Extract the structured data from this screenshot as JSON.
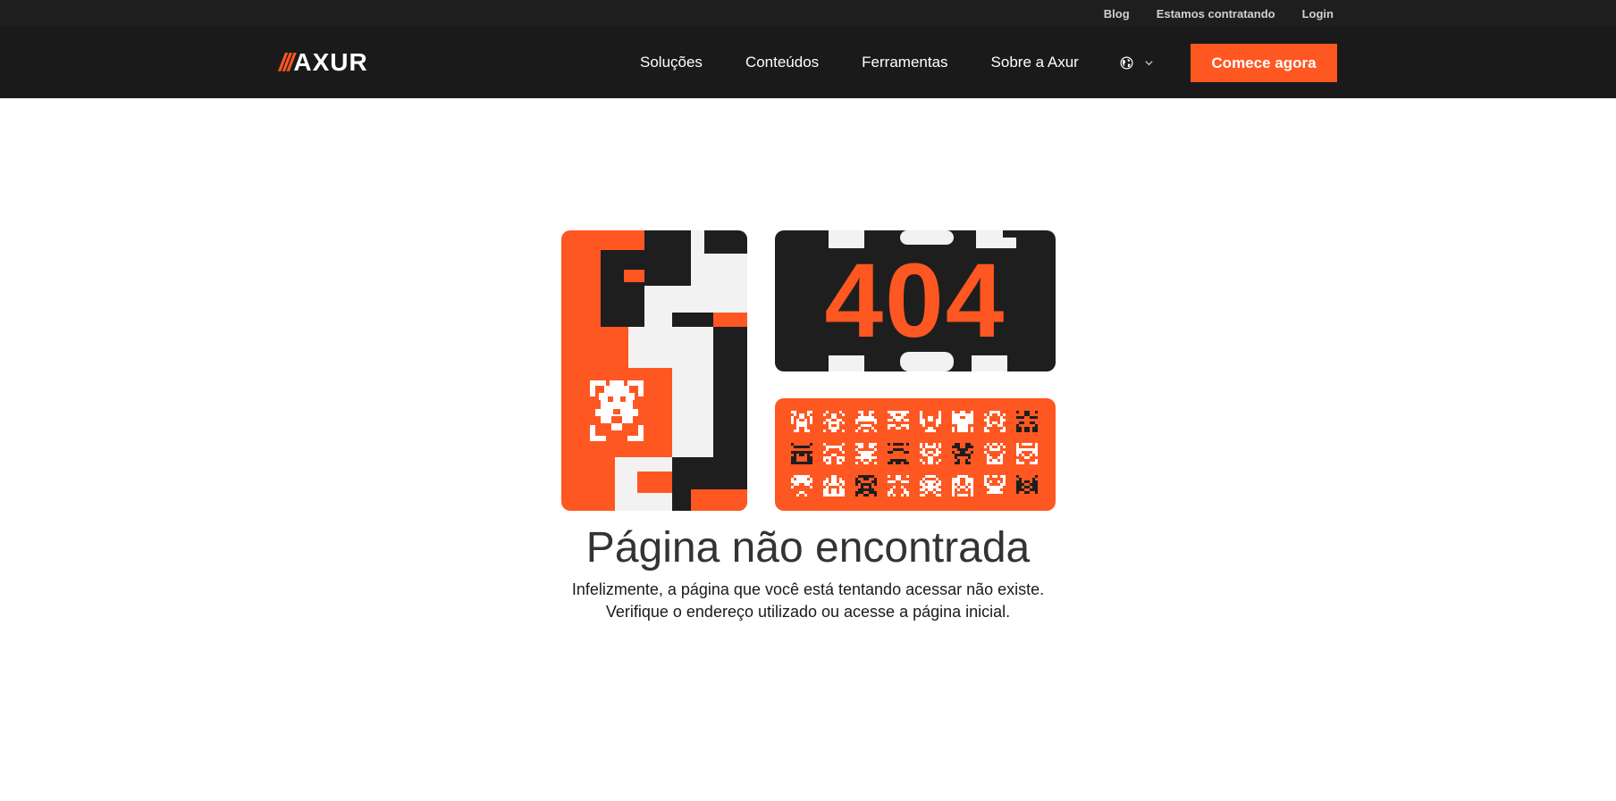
{
  "topbar": {
    "links": [
      "Blog",
      "Estamos contratando",
      "Login"
    ]
  },
  "brand": {
    "slashes": "///",
    "name": "AXUR"
  },
  "nav": {
    "items": [
      "Soluções",
      "Conteúdos",
      "Ferramentas",
      "Sobre a Axur"
    ],
    "language_icon": "globe-icon",
    "language_chevron": "chevron-down-icon",
    "cta_label": "Comece agora"
  },
  "illustration": {
    "code": "404"
  },
  "error": {
    "title": "Página não encontrada",
    "line1": "Infelizmente, a página que você está tentando acessar não existe.",
    "line2": "Verifique o endereço utilizado ou acesse a página inicial."
  },
  "colors": {
    "accent": "#ff5722",
    "dark": "#1e1e1e",
    "light": "#f2f2f2"
  }
}
